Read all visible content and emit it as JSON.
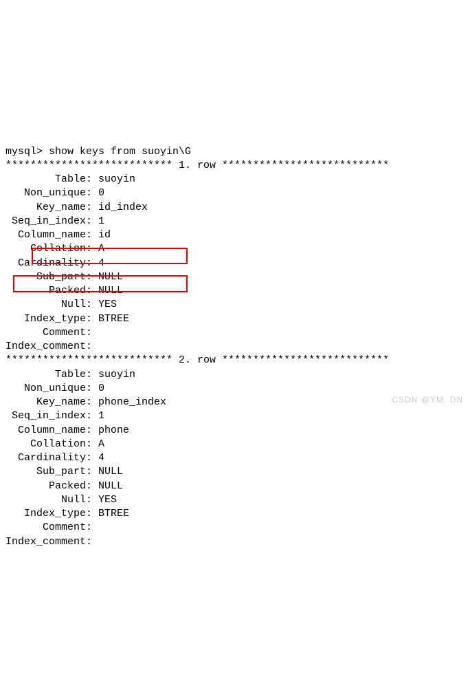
{
  "prompt": "mysql> ",
  "command": "show keys from suoyin\\G",
  "row_label_prefix": "***************************",
  "row_label_suffix": "***************************",
  "row_word": "row",
  "labels": {
    "Table": "Table",
    "Non_unique": "Non_unique",
    "Key_name": "Key_name",
    "Seq_in_index": "Seq_in_index",
    "Column_name": "Column_name",
    "Collation": "Collation",
    "Cardinality": "Cardinality",
    "Sub_part": "Sub_part",
    "Packed": "Packed",
    "Null": "Null",
    "Index_type": "Index_type",
    "Comment": "Comment",
    "Index_comment": "Index_comment"
  },
  "rows": [
    {
      "n": "1.",
      "Table": "suoyin",
      "Non_unique": "0",
      "Key_name": "id_index",
      "Seq_in_index": "1",
      "Column_name": "id",
      "Collation": "A",
      "Cardinality": "4",
      "Sub_part": "NULL",
      "Packed": "NULL",
      "Null": "YES",
      "Index_type": "BTREE",
      "Comment": "",
      "Index_comment": ""
    },
    {
      "n": "2.",
      "Table": "suoyin",
      "Non_unique": "0",
      "Key_name": "phone_index",
      "Seq_in_index": "1",
      "Column_name": "phone",
      "Collation": "A",
      "Cardinality": "4",
      "Sub_part": "NULL",
      "Packed": "NULL",
      "Null": "YES",
      "Index_type": "BTREE",
      "Comment": "",
      "Index_comment": ""
    }
  ],
  "watermark": "CSDN @YM  DN"
}
